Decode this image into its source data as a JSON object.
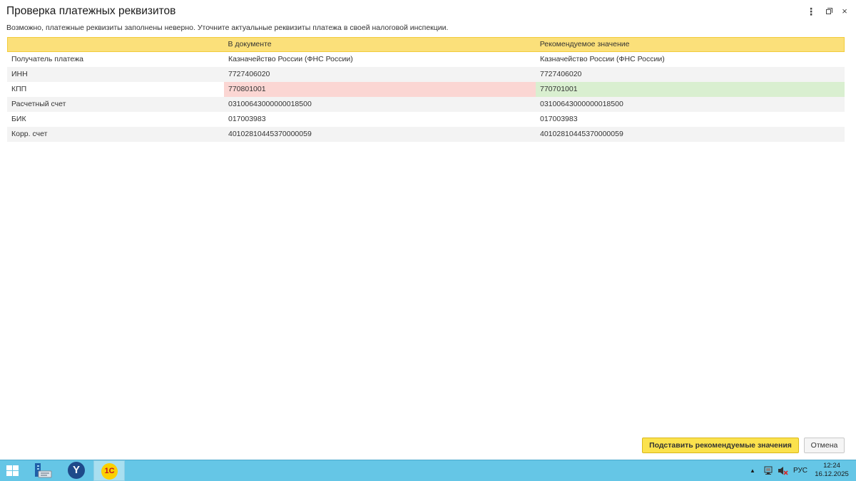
{
  "window": {
    "title": "Проверка платежных реквизитов",
    "subtitle": "Возможно, платежные реквизиты заполнены неверно. Уточните актуальные реквизиты платежа в своей налоговой инспекции.",
    "controls": {
      "menu": "⋮",
      "close": "×"
    }
  },
  "table": {
    "columns": [
      "",
      "В документе",
      "Рекомендуемое значение"
    ],
    "rows": [
      {
        "label": "Получатель платежа",
        "document": "Казначейство России (ФНС России)",
        "recommended": "Казначейство России (ФНС России)",
        "mismatch": false
      },
      {
        "label": "ИНН",
        "document": "7727406020",
        "recommended": "7727406020",
        "mismatch": false
      },
      {
        "label": "КПП",
        "document": "770801001",
        "recommended": "770701001",
        "mismatch": true
      },
      {
        "label": "Расчетный счет",
        "document": "03100643000000018500",
        "recommended": "03100643000000018500",
        "mismatch": false
      },
      {
        "label": "БИК",
        "document": "017003983",
        "recommended": "017003983",
        "mismatch": false
      },
      {
        "label": "Корр. счет",
        "document": "40102810445370000059",
        "recommended": "40102810445370000059",
        "mismatch": false
      }
    ]
  },
  "buttons": {
    "apply": "Подставить рекомендуемые значения",
    "cancel": "Отмена"
  },
  "colors": {
    "header_bg": "#fbe07a",
    "mismatch_document": "#fbd6d3",
    "mismatch_recommended": "#d9efd0",
    "primary_button": "#fbe24d",
    "taskbar": "#65c6e6"
  },
  "taskbar": {
    "icons": [
      "windows-start-icon",
      "file-explorer-icon",
      "yandex-browser-icon",
      "1c-enterprise-icon"
    ],
    "yandex_letter": "Y",
    "onec_label": "1С",
    "tray_arrow": "▲",
    "tray_lang": "РУС",
    "time": "12:24",
    "date": "16.12.2025"
  }
}
